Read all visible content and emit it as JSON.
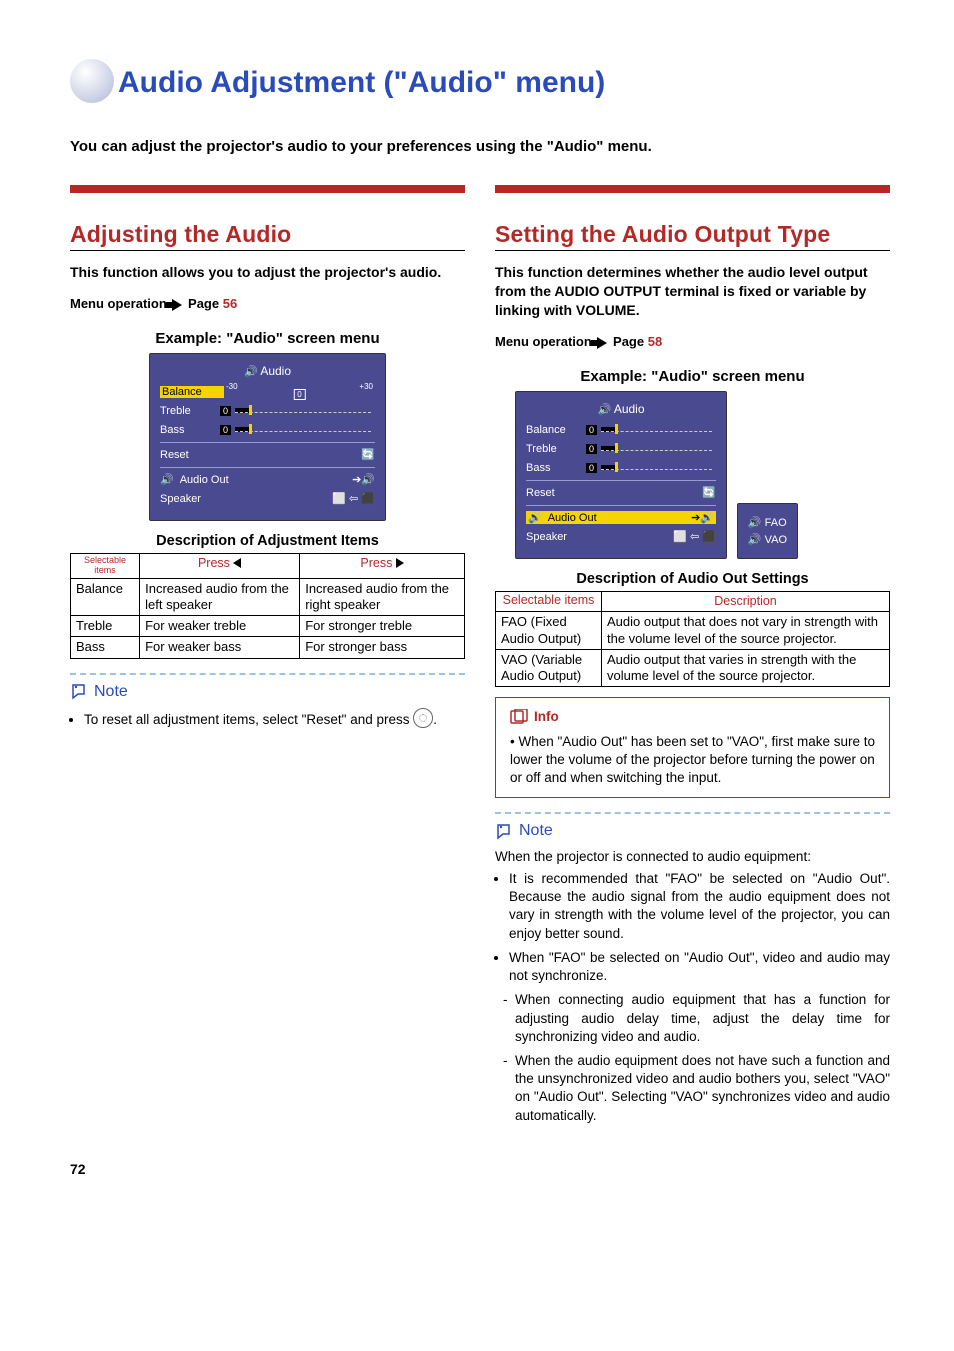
{
  "page_title": "Audio Adjustment (\"Audio\" menu)",
  "intro": "You can adjust the projector's audio to your preferences using the \"Audio\" menu.",
  "page_number": "72",
  "left": {
    "heading": "Adjusting the Audio",
    "desc": "This function allows you to adjust the projector's audio.",
    "menu_op_prefix": "Menu operation",
    "menu_op_page_label": "Page",
    "menu_op_page": "56",
    "example_label": "Example: \"Audio\" screen menu",
    "osd": {
      "title": "Audio",
      "rows": [
        "Balance",
        "Treble",
        "Bass",
        "Reset",
        "Audio Out",
        "Speaker"
      ],
      "balance_scale": [
        "-30",
        "0",
        "+30"
      ],
      "slider_zero": "0"
    },
    "table_title": "Description of Adjustment Items",
    "table": {
      "headers": [
        "Selectable items",
        "Press ◀",
        "Press ▶"
      ],
      "rows": [
        {
          "item": "Balance",
          "left": "Increased audio from the left speaker",
          "right": "Increased audio from the right speaker"
        },
        {
          "item": "Treble",
          "left": "For weaker treble",
          "right": "For stronger treble"
        },
        {
          "item": "Bass",
          "left": "For weaker bass",
          "right": "For stronger bass"
        }
      ]
    },
    "note_label": "Note",
    "note_item": "To reset all adjustment items, select \"Reset\" and press",
    "note_item_tail": "."
  },
  "right": {
    "heading": "Setting the Audio Output Type",
    "desc": "This function determines whether the audio level output from the AUDIO OUTPUT terminal is fixed or variable by linking with VOLUME.",
    "menu_op_prefix": "Menu operation",
    "menu_op_page_label": "Page",
    "menu_op_page": "58",
    "example_label": "Example: \"Audio\" screen menu",
    "osd": {
      "title": "Audio",
      "rows": [
        "Balance",
        "Treble",
        "Bass",
        "Reset",
        "Audio Out",
        "Speaker"
      ],
      "slider_zero": "0",
      "popup": [
        "FAO",
        "VAO"
      ]
    },
    "table_title": "Description of Audio Out Settings",
    "table": {
      "headers": [
        "Selectable items",
        "Description"
      ],
      "rows": [
        {
          "item": "FAO (Fixed Audio Output)",
          "desc": "Audio output that does not vary in strength with the volume level of the source projector."
        },
        {
          "item": "VAO (Variable Audio Output)",
          "desc": "Audio output that varies in strength with the volume level of the source projector."
        }
      ]
    },
    "info_label": "Info",
    "info_item": "When \"Audio Out\" has been set to \"VAO\", first make sure to lower the volume of the projector before turning the power on or off and when switching the input.",
    "note_label": "Note",
    "note_intro": "When the projector is connected to audio equipment:",
    "note_items": [
      "It is recommended that \"FAO\" be selected on \"Audio Out\". Because the audio signal from the audio equipment does not vary in strength with the volume level of the projector, you can enjoy better sound.",
      "When \"FAO\" be selected on \"Audio Out\", video and audio may not synchronize."
    ],
    "note_subitems": [
      "When connecting audio equipment that has a function for adjusting audio delay time, adjust the delay time for synchronizing video and audio.",
      "When the audio equipment does not have such a function and the unsynchronized video and audio bothers you, select \"VAO\" on \"Audio Out\". Selecting \"VAO\" synchronizes video and audio automatically."
    ]
  }
}
